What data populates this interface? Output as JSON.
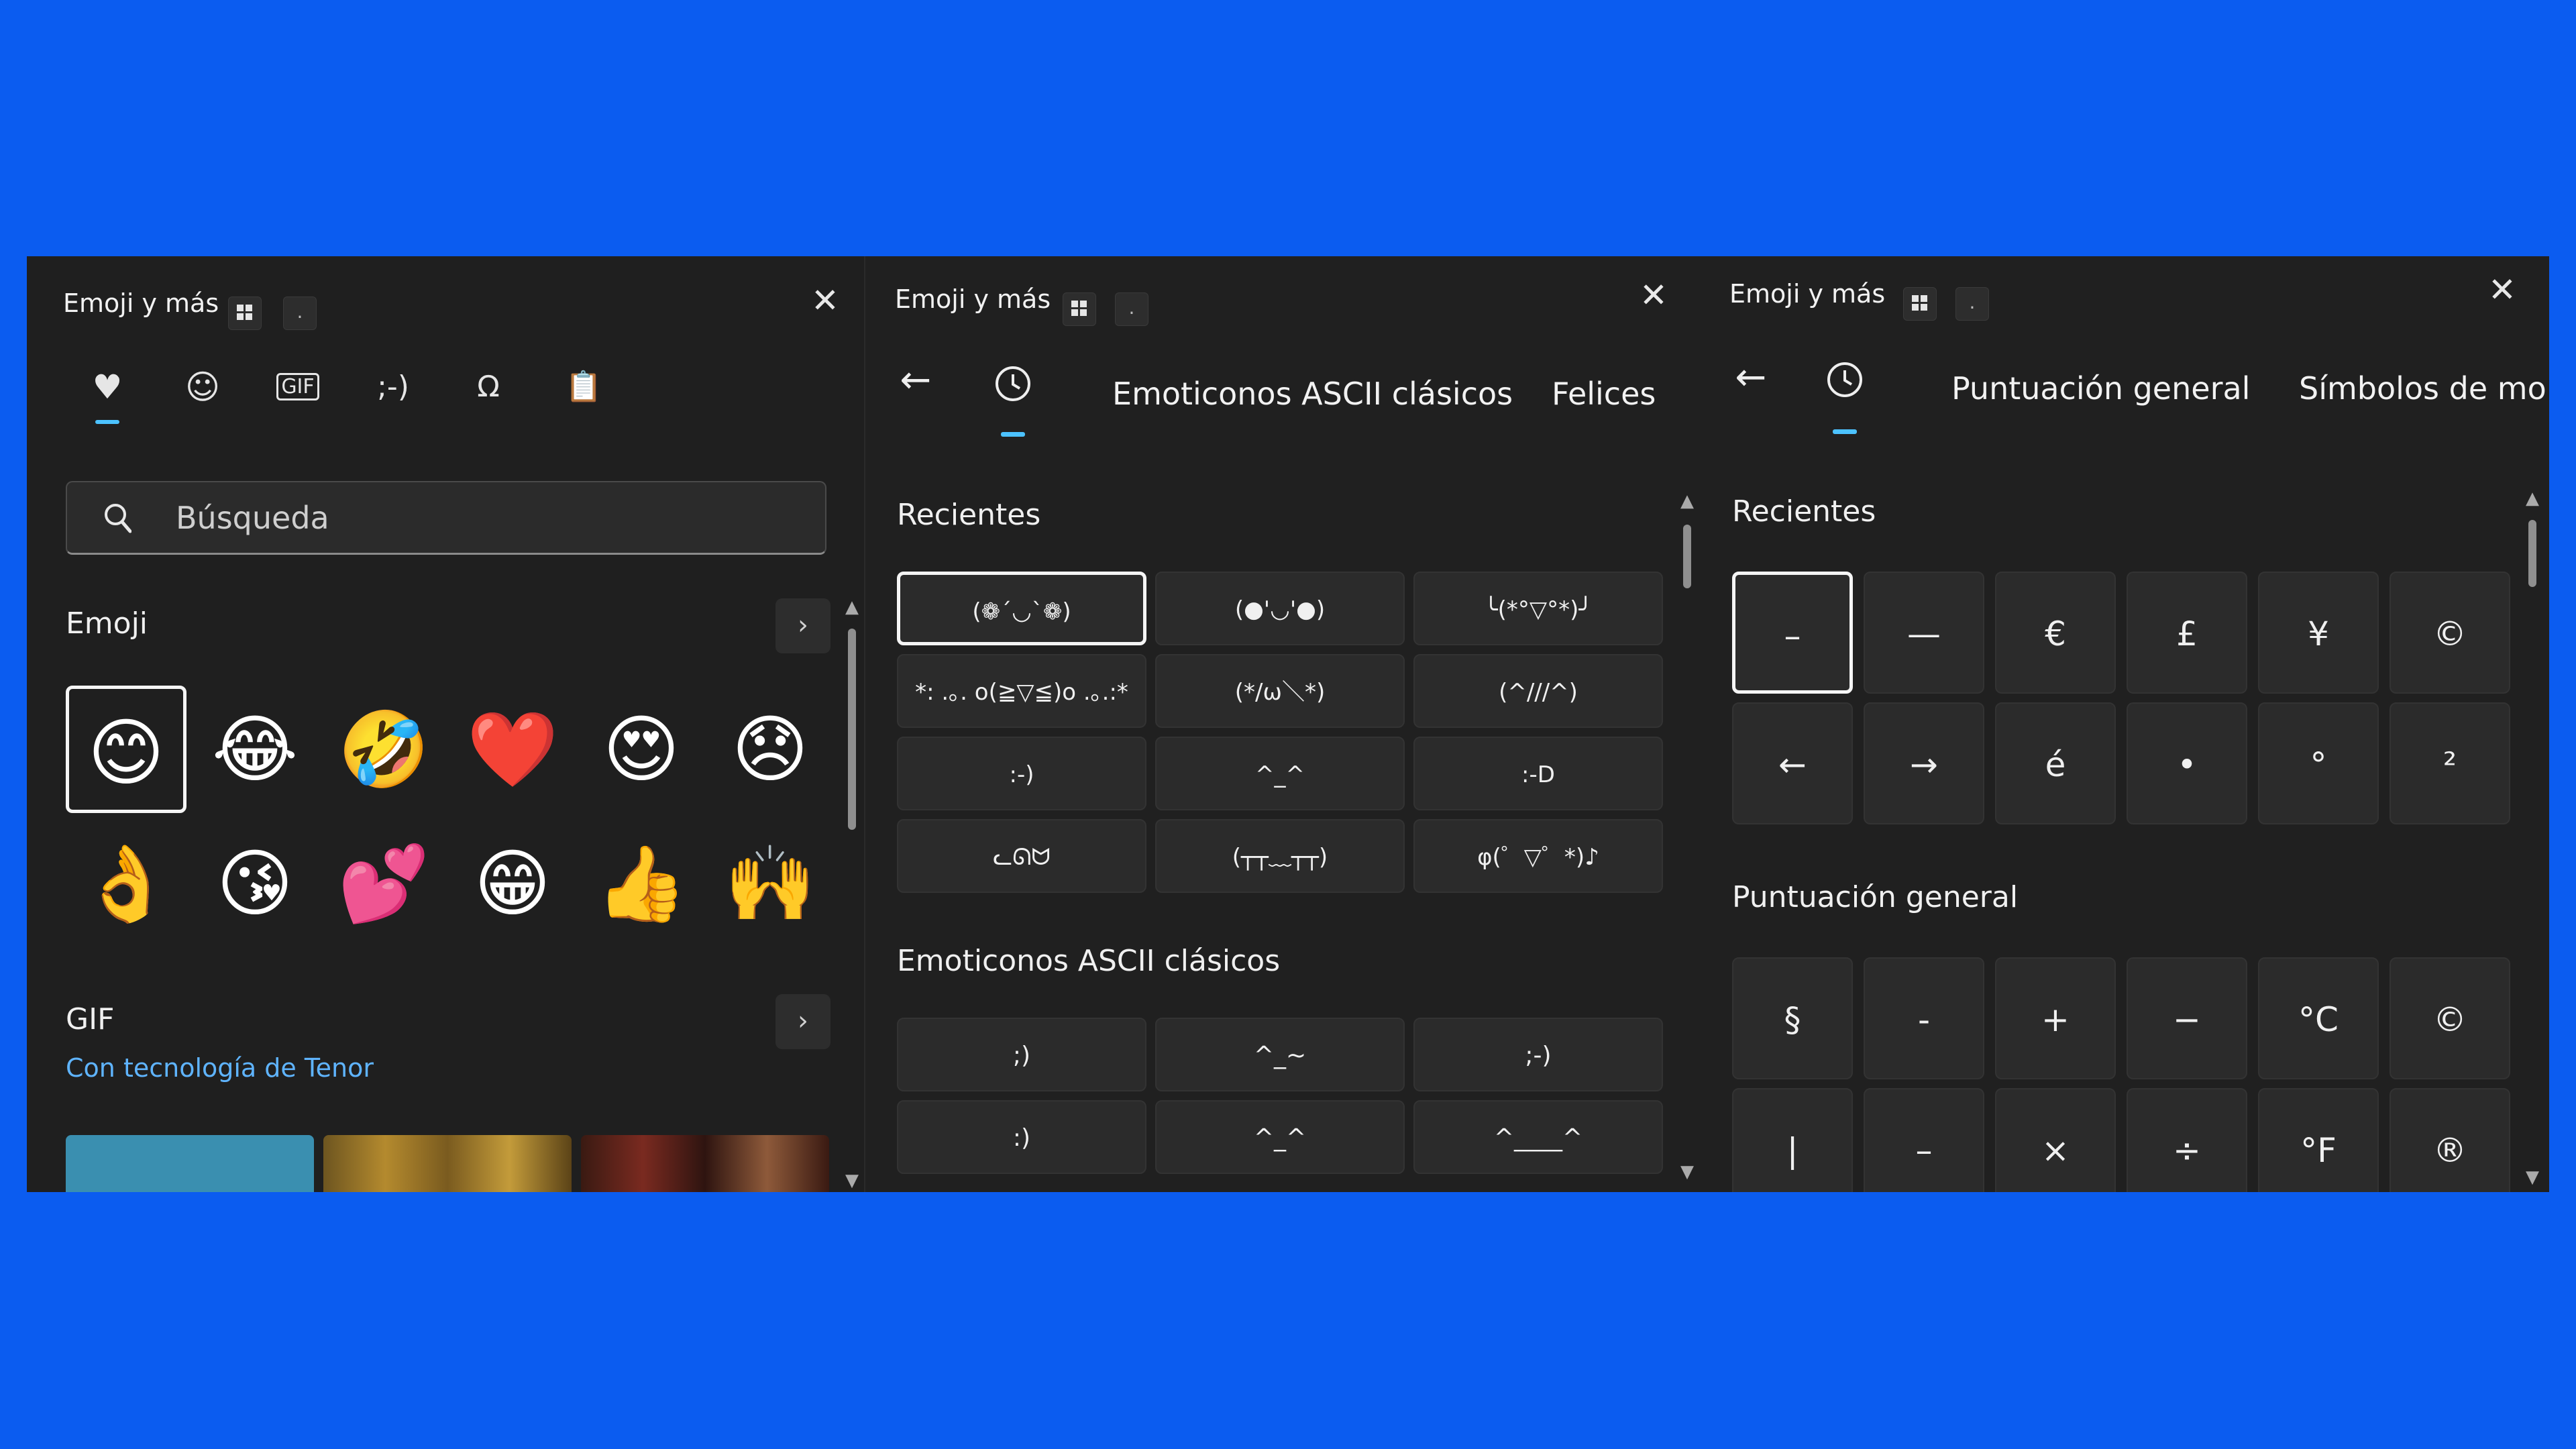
{
  "background_color": "#0b5cf0",
  "accent_color": "#4cc2ff",
  "panel1": {
    "title": "Emoji y más",
    "kbd_dot": ".",
    "close": "✕",
    "tabs": [
      "heart-emoji-icon",
      "smiley-icon",
      "gif-icon",
      "kaomoji-icon",
      "symbols-icon",
      "clipboard-icon"
    ],
    "tab_glyphs": [
      "♥",
      "☺",
      "GIF",
      ";-)",
      "Ω",
      "📋"
    ],
    "search_placeholder": "Búsqueda",
    "emoji_header": "Emoji",
    "emojis_row1": [
      "😊",
      "😂",
      "🤣",
      "❤️",
      "😍",
      "😞"
    ],
    "emojis_row2": [
      "👌",
      "😘",
      "💕",
      "😁",
      "👍",
      "🙌"
    ],
    "gif_header": "GIF",
    "gif_link": "Con tecnología de Tenor",
    "arrow": "›"
  },
  "panel2": {
    "title": "Emoji y más",
    "kbd_dot": ".",
    "close": "✕",
    "back": "←",
    "tab1": "Emoticonos ASCII clásicos",
    "tab2": "Felices",
    "recent_header": "Recientes",
    "recent_items": [
      "(❁´◡`❁)",
      "(●'◡'●)",
      "╰(*°▽°*)╯",
      "*: .｡. o(≧▽≦)o .｡.:*",
      "(*/ω＼*)",
      "(^///^)",
      ":-)",
      "^_^",
      ":-D",
      "ᓚᘏᗢ",
      "(┬┬﹏┬┬)",
      " φ(゜▽゜*)♪"
    ],
    "classic_header": "Emoticonos ASCII clásicos",
    "classic_items": [
      ";)",
      "^_~",
      ";-)",
      ":)",
      "^_^",
      "^____^"
    ]
  },
  "panel3": {
    "title": "Emoji y más",
    "kbd_dot": ".",
    "close": "✕",
    "back": "←",
    "tab1": "Puntuación general",
    "tab2": "Símbolos de mo",
    "recent_header": "Recientes",
    "recent_items": [
      "–",
      "—",
      "€",
      "£",
      "¥",
      "©",
      "←",
      "→",
      "é",
      "•",
      "°",
      "²"
    ],
    "punct_header": "Puntuación general",
    "punct_items": [
      "§",
      "-",
      "+",
      "−",
      "°C",
      "©",
      "|",
      "–",
      "×",
      "÷",
      "°F",
      "®"
    ]
  }
}
